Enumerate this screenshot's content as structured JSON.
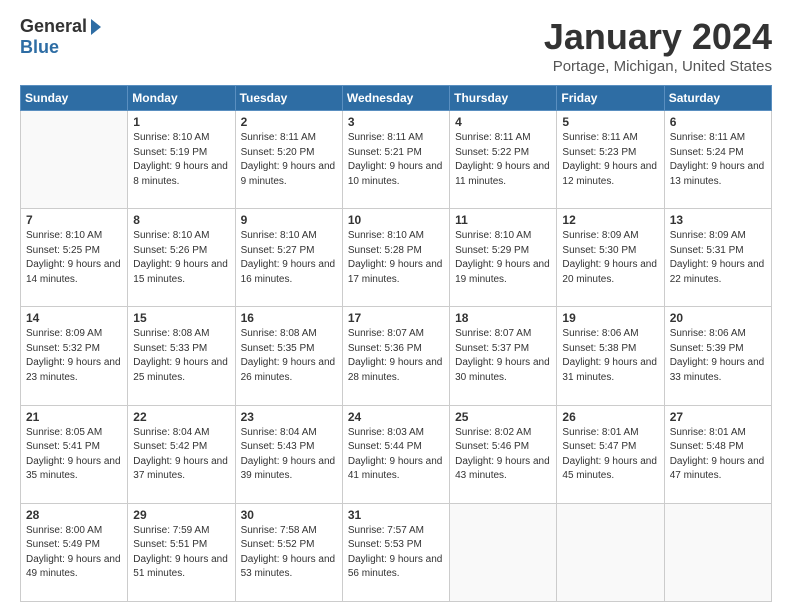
{
  "header": {
    "logo_general": "General",
    "logo_blue": "Blue",
    "title": "January 2024",
    "location": "Portage, Michigan, United States"
  },
  "days_of_week": [
    "Sunday",
    "Monday",
    "Tuesday",
    "Wednesday",
    "Thursday",
    "Friday",
    "Saturday"
  ],
  "weeks": [
    [
      {
        "day": "",
        "sunrise": "",
        "sunset": "",
        "daylight": ""
      },
      {
        "day": "1",
        "sunrise": "Sunrise: 8:10 AM",
        "sunset": "Sunset: 5:19 PM",
        "daylight": "Daylight: 9 hours and 8 minutes."
      },
      {
        "day": "2",
        "sunrise": "Sunrise: 8:11 AM",
        "sunset": "Sunset: 5:20 PM",
        "daylight": "Daylight: 9 hours and 9 minutes."
      },
      {
        "day": "3",
        "sunrise": "Sunrise: 8:11 AM",
        "sunset": "Sunset: 5:21 PM",
        "daylight": "Daylight: 9 hours and 10 minutes."
      },
      {
        "day": "4",
        "sunrise": "Sunrise: 8:11 AM",
        "sunset": "Sunset: 5:22 PM",
        "daylight": "Daylight: 9 hours and 11 minutes."
      },
      {
        "day": "5",
        "sunrise": "Sunrise: 8:11 AM",
        "sunset": "Sunset: 5:23 PM",
        "daylight": "Daylight: 9 hours and 12 minutes."
      },
      {
        "day": "6",
        "sunrise": "Sunrise: 8:11 AM",
        "sunset": "Sunset: 5:24 PM",
        "daylight": "Daylight: 9 hours and 13 minutes."
      }
    ],
    [
      {
        "day": "7",
        "sunrise": "Sunrise: 8:10 AM",
        "sunset": "Sunset: 5:25 PM",
        "daylight": "Daylight: 9 hours and 14 minutes."
      },
      {
        "day": "8",
        "sunrise": "Sunrise: 8:10 AM",
        "sunset": "Sunset: 5:26 PM",
        "daylight": "Daylight: 9 hours and 15 minutes."
      },
      {
        "day": "9",
        "sunrise": "Sunrise: 8:10 AM",
        "sunset": "Sunset: 5:27 PM",
        "daylight": "Daylight: 9 hours and 16 minutes."
      },
      {
        "day": "10",
        "sunrise": "Sunrise: 8:10 AM",
        "sunset": "Sunset: 5:28 PM",
        "daylight": "Daylight: 9 hours and 17 minutes."
      },
      {
        "day": "11",
        "sunrise": "Sunrise: 8:10 AM",
        "sunset": "Sunset: 5:29 PM",
        "daylight": "Daylight: 9 hours and 19 minutes."
      },
      {
        "day": "12",
        "sunrise": "Sunrise: 8:09 AM",
        "sunset": "Sunset: 5:30 PM",
        "daylight": "Daylight: 9 hours and 20 minutes."
      },
      {
        "day": "13",
        "sunrise": "Sunrise: 8:09 AM",
        "sunset": "Sunset: 5:31 PM",
        "daylight": "Daylight: 9 hours and 22 minutes."
      }
    ],
    [
      {
        "day": "14",
        "sunrise": "Sunrise: 8:09 AM",
        "sunset": "Sunset: 5:32 PM",
        "daylight": "Daylight: 9 hours and 23 minutes."
      },
      {
        "day": "15",
        "sunrise": "Sunrise: 8:08 AM",
        "sunset": "Sunset: 5:33 PM",
        "daylight": "Daylight: 9 hours and 25 minutes."
      },
      {
        "day": "16",
        "sunrise": "Sunrise: 8:08 AM",
        "sunset": "Sunset: 5:35 PM",
        "daylight": "Daylight: 9 hours and 26 minutes."
      },
      {
        "day": "17",
        "sunrise": "Sunrise: 8:07 AM",
        "sunset": "Sunset: 5:36 PM",
        "daylight": "Daylight: 9 hours and 28 minutes."
      },
      {
        "day": "18",
        "sunrise": "Sunrise: 8:07 AM",
        "sunset": "Sunset: 5:37 PM",
        "daylight": "Daylight: 9 hours and 30 minutes."
      },
      {
        "day": "19",
        "sunrise": "Sunrise: 8:06 AM",
        "sunset": "Sunset: 5:38 PM",
        "daylight": "Daylight: 9 hours and 31 minutes."
      },
      {
        "day": "20",
        "sunrise": "Sunrise: 8:06 AM",
        "sunset": "Sunset: 5:39 PM",
        "daylight": "Daylight: 9 hours and 33 minutes."
      }
    ],
    [
      {
        "day": "21",
        "sunrise": "Sunrise: 8:05 AM",
        "sunset": "Sunset: 5:41 PM",
        "daylight": "Daylight: 9 hours and 35 minutes."
      },
      {
        "day": "22",
        "sunrise": "Sunrise: 8:04 AM",
        "sunset": "Sunset: 5:42 PM",
        "daylight": "Daylight: 9 hours and 37 minutes."
      },
      {
        "day": "23",
        "sunrise": "Sunrise: 8:04 AM",
        "sunset": "Sunset: 5:43 PM",
        "daylight": "Daylight: 9 hours and 39 minutes."
      },
      {
        "day": "24",
        "sunrise": "Sunrise: 8:03 AM",
        "sunset": "Sunset: 5:44 PM",
        "daylight": "Daylight: 9 hours and 41 minutes."
      },
      {
        "day": "25",
        "sunrise": "Sunrise: 8:02 AM",
        "sunset": "Sunset: 5:46 PM",
        "daylight": "Daylight: 9 hours and 43 minutes."
      },
      {
        "day": "26",
        "sunrise": "Sunrise: 8:01 AM",
        "sunset": "Sunset: 5:47 PM",
        "daylight": "Daylight: 9 hours and 45 minutes."
      },
      {
        "day": "27",
        "sunrise": "Sunrise: 8:01 AM",
        "sunset": "Sunset: 5:48 PM",
        "daylight": "Daylight: 9 hours and 47 minutes."
      }
    ],
    [
      {
        "day": "28",
        "sunrise": "Sunrise: 8:00 AM",
        "sunset": "Sunset: 5:49 PM",
        "daylight": "Daylight: 9 hours and 49 minutes."
      },
      {
        "day": "29",
        "sunrise": "Sunrise: 7:59 AM",
        "sunset": "Sunset: 5:51 PM",
        "daylight": "Daylight: 9 hours and 51 minutes."
      },
      {
        "day": "30",
        "sunrise": "Sunrise: 7:58 AM",
        "sunset": "Sunset: 5:52 PM",
        "daylight": "Daylight: 9 hours and 53 minutes."
      },
      {
        "day": "31",
        "sunrise": "Sunrise: 7:57 AM",
        "sunset": "Sunset: 5:53 PM",
        "daylight": "Daylight: 9 hours and 56 minutes."
      },
      {
        "day": "",
        "sunrise": "",
        "sunset": "",
        "daylight": ""
      },
      {
        "day": "",
        "sunrise": "",
        "sunset": "",
        "daylight": ""
      },
      {
        "day": "",
        "sunrise": "",
        "sunset": "",
        "daylight": ""
      }
    ]
  ]
}
